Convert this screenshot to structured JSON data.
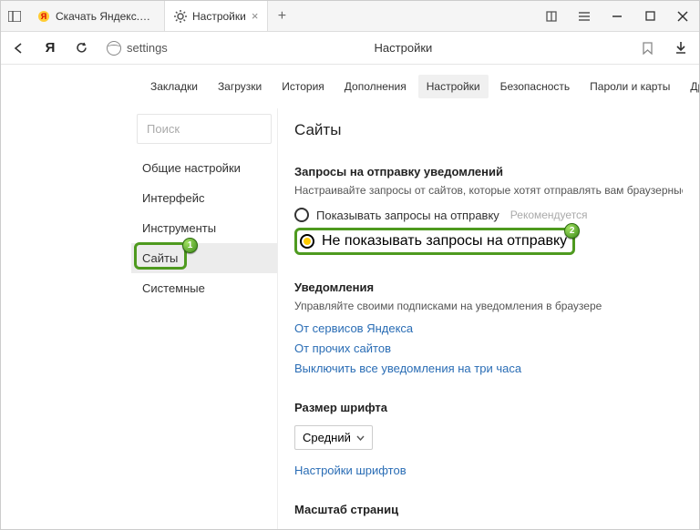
{
  "titlebar": {
    "tabs": [
      {
        "title": "Скачать Яндекс.Браузер д"
      },
      {
        "title": "Настройки"
      }
    ]
  },
  "addrbar": {
    "url": "settings",
    "page_title": "Настройки"
  },
  "topnav": {
    "items": [
      "Закладки",
      "Загрузки",
      "История",
      "Дополнения",
      "Настройки",
      "Безопасность",
      "Пароли и карты",
      "Другие устр"
    ],
    "active_index": 4
  },
  "sidebar": {
    "search_placeholder": "Поиск",
    "items": [
      "Общие настройки",
      "Интерфейс",
      "Инструменты",
      "Сайты",
      "Системные"
    ],
    "active_index": 3
  },
  "main": {
    "heading": "Сайты",
    "notifications_request": {
      "title": "Запросы на отправку уведомлений",
      "desc": "Настраивайте запросы от сайтов, которые хотят отправлять вам браузерные уве",
      "option_show": "Показывать запросы на отправку",
      "recommended": "Рекомендуется",
      "option_hide": "Не показывать запросы на отправку"
    },
    "notifications": {
      "title": "Уведомления",
      "desc": "Управляйте своими подписками на уведомления в браузере",
      "link_yandex": "От сервисов Яндекса",
      "link_other": "От прочих сайтов",
      "link_disable": "Выключить все уведомления на три часа"
    },
    "font_size": {
      "title": "Размер шрифта",
      "value": "Средний",
      "link_fonts": "Настройки шрифтов"
    },
    "zoom": {
      "title": "Масштаб страниц"
    }
  },
  "annotations": {
    "badge1": "1",
    "badge2": "2"
  }
}
